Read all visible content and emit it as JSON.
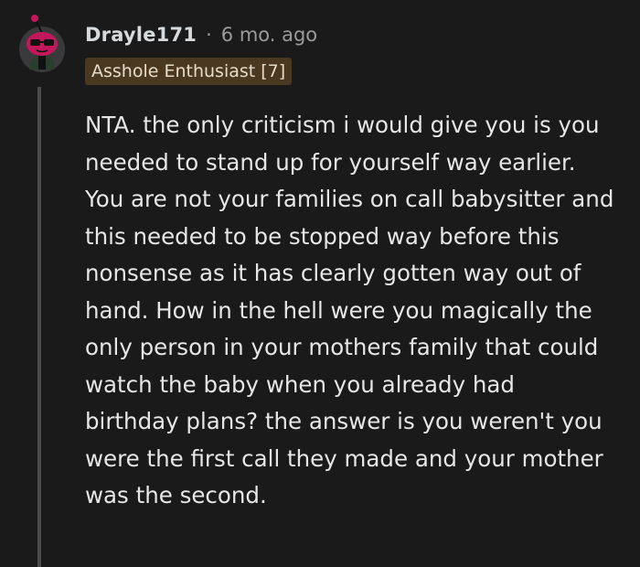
{
  "comment": {
    "username": "Drayle171",
    "separator": "·",
    "timestamp": "6 mo. ago",
    "flair": "Asshole Enthusiast [7]",
    "body": "NTA. the only criticism i would give you is you needed to stand up for yourself way earlier. You are not your families on call babysitter and this needed to be stopped way before this nonsense as it has clearly gotten way out of hand. How in the hell were you magically the only person in your mothers family that could watch the baby when you already had birthday plans? the answer is you weren't you were the first call they made and your mother was the second."
  },
  "colors": {
    "background": "#1a1a1b",
    "thread_line": "#4a4a4c",
    "flair_background": "#4b3820",
    "text": "#e6e6e6",
    "meta_text": "#9b9b9b",
    "avatar_head": "#c2185b"
  },
  "icons": {
    "avatar": "snoo-avatar-icon"
  }
}
